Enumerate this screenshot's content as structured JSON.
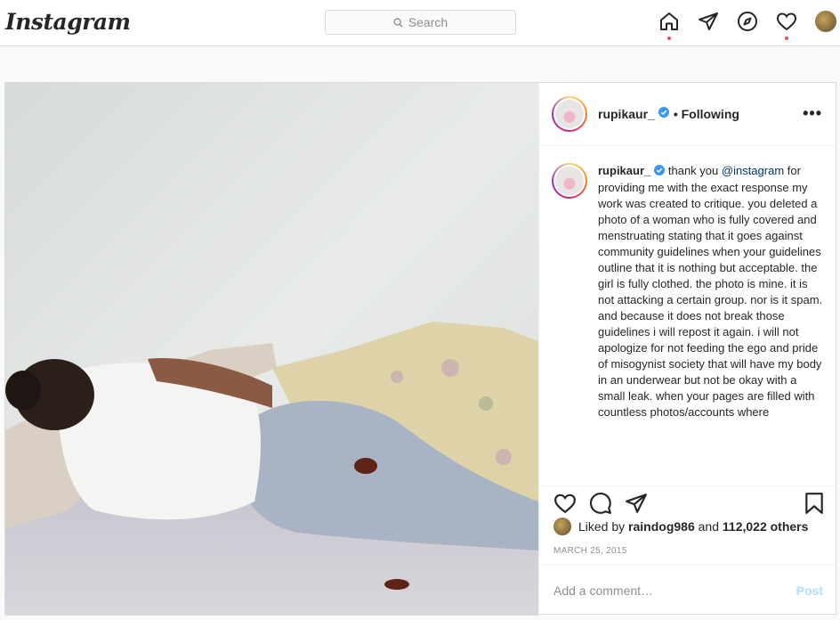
{
  "header": {
    "logo": "Instagram",
    "search_placeholder": "Search",
    "nav_icons": [
      "home-icon",
      "direct-icon",
      "explore-icon",
      "activity-icon",
      "profile-avatar"
    ]
  },
  "post": {
    "username": "rupikaur_",
    "follow_status": "• Following",
    "more_label": "•••",
    "caption_username": "rupikaur_",
    "caption_pre": "thank you",
    "caption_mention": "@instagram",
    "caption_text": "for providing me with the exact response my work was created to critique. you deleted a photo of a woman who is fully covered and menstruating stating that it goes against community guidelines when your guidelines outline that it is nothing but acceptable. the girl is fully clothed. the photo is mine. it is not attacking a certain group. nor is it spam. and because it does not break those guidelines i will repost it again. i will not apologize for not feeding the ego and pride of misogynist society that will have my body in an underwear but not be okay with a small leak. when your pages are filled with countless photos/accounts where",
    "liked_by_prefix": "Liked by",
    "liked_by_user": "raindog986",
    "liked_by_and": "and",
    "liked_by_count": "112,022 others",
    "date": "MARCH 25, 2015",
    "comment_placeholder": "Add a comment…",
    "post_button": "Post"
  },
  "colors": {
    "notification_dot": "#ed4956",
    "verified": "#3897f0",
    "link": "#00376b",
    "post_button": "#b2dffc"
  }
}
